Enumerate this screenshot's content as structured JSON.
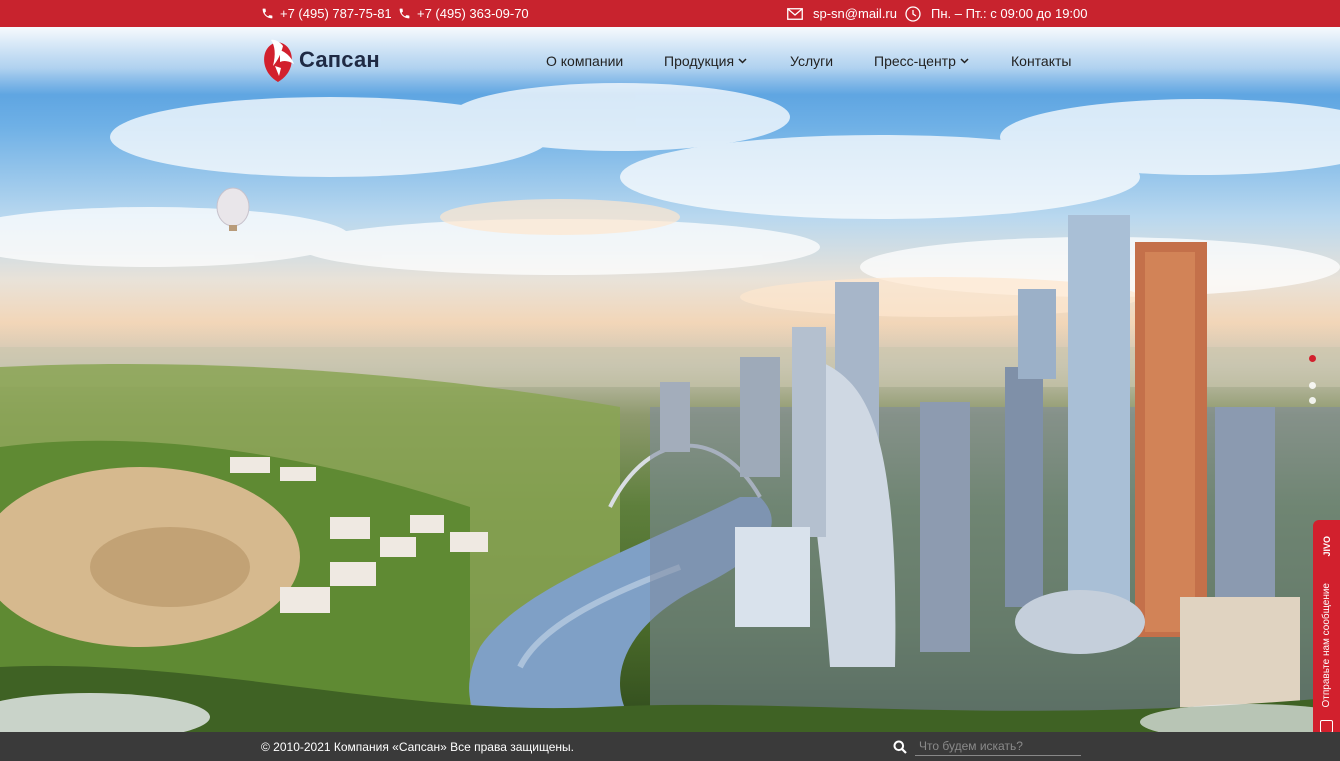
{
  "topbar": {
    "phone1": "+7 (495) 787-75-81",
    "phone2": "+7 (495) 363-09-70",
    "email": "sp-sn@mail.ru",
    "hours": "Пн. – Пт.: с 09:00 до 19:00",
    "icons": [
      "phone-icon",
      "phone-icon",
      "mail-icon",
      "clock-icon"
    ]
  },
  "header": {
    "logo_text": "Сапсан",
    "nav": [
      {
        "label": "О компании",
        "has_dropdown": false
      },
      {
        "label": "Продукция",
        "has_dropdown": true
      },
      {
        "label": "Услуги",
        "has_dropdown": false
      },
      {
        "label": "Пресс-центр",
        "has_dropdown": true
      },
      {
        "label": "Контакты",
        "has_dropdown": false
      }
    ]
  },
  "slider": {
    "slide_count": 3,
    "active_index": 0
  },
  "chat_widget": {
    "brand": "JIVO",
    "label": "Отправьте нам сообщение"
  },
  "footer": {
    "copyright": "© 2010-2021 Компания «Сапсан» Все права защищены.",
    "search_placeholder": "Что будем искать?"
  },
  "colors": {
    "brand_red": "#c8232e",
    "footer_bg": "#3a3a3a",
    "nav_text": "#222222"
  }
}
